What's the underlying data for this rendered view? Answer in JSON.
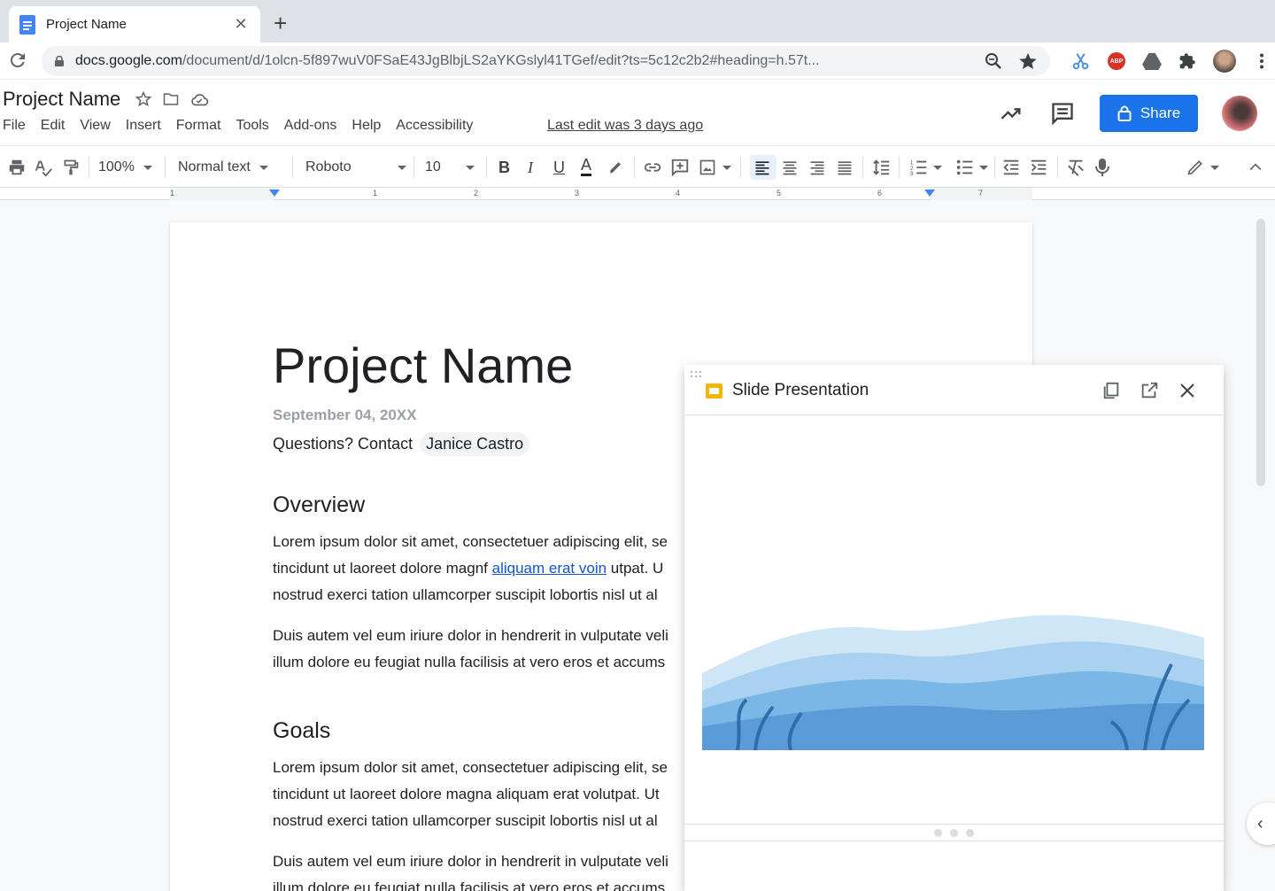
{
  "browser": {
    "tab_title": "Project Name",
    "url_host": "docs.google.com",
    "url_path": "/document/d/1olcn-5f897wuV0FSaE43JgBlbjLS2aYKGslyl41TGef/edit?ts=5c12c2b2#heading=h.57t..."
  },
  "docs": {
    "title": "Project Name",
    "menu": [
      "File",
      "Edit",
      "View",
      "Insert",
      "Format",
      "Tools",
      "Add-ons",
      "Help",
      "Accessibility"
    ],
    "last_edit": "Last edit was 3 days ago",
    "share_label": "Share",
    "accent_color": "#1a73e8"
  },
  "toolbar": {
    "zoom": "100%",
    "style": "Normal text",
    "font": "Roboto",
    "size": "10"
  },
  "ruler": {
    "numbers": [
      "1",
      "1",
      "2",
      "3",
      "4",
      "5",
      "6",
      "7"
    ]
  },
  "document": {
    "heading": "Project Name",
    "date": "September 04, 20XX",
    "contact_label": "Questions? Contact",
    "contact_name": "Janice Castro",
    "overview_heading": "Overview",
    "overview_p1_line1": "Lorem ipsum dolor sit amet, consectetuer adipiscing elit, se",
    "overview_p1_line2_before": "tincidunt ut laoreet dolore magnf ",
    "overview_p1_link": "aliquam erat voin",
    "overview_p1_line2_after": " utpat. U",
    "overview_p1_line3": "nostrud exerci tation ullamcorper suscipit lobortis nisl ut al",
    "overview_p2_line1": "Duis autem vel eum iriure dolor in hendrerit in vulputate veli",
    "overview_p2_line2": "illum dolore eu feugiat nulla facilisis at vero eros et accums",
    "goals_heading": "Goals",
    "goals_p1_line1": "Lorem ipsum dolor sit amet, consectetuer adipiscing elit, se",
    "goals_p1_line2": "tincidunt ut laoreet dolore magna aliquam erat volutpat. Ut",
    "goals_p1_line3": "nostrud exerci tation ullamcorper suscipit lobortis nisl ut al",
    "goals_p2_line1": "Duis autem vel eum iriure dolor in hendrerit in vulputate veli",
    "goals_p2_line2": "illum dolore eu feugiat nulla facilisis at vero eros et accums"
  },
  "panel": {
    "title": "Slide Presentation"
  }
}
